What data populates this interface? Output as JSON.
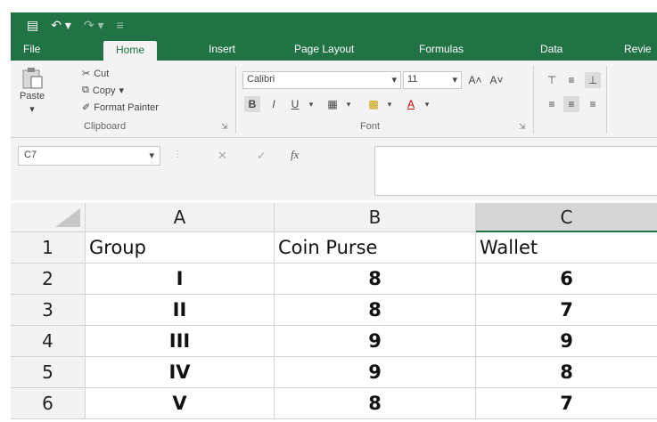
{
  "quick_access": {
    "save_glyph": "▤",
    "undo_glyph": "↶ ▾",
    "redo_glyph": "↷ ▾",
    "customize_glyph": "≡"
  },
  "tabs": [
    "File",
    "Home",
    "Insert",
    "Page Layout",
    "Formulas",
    "Data",
    "Revie"
  ],
  "clipboard": {
    "paste": "Paste",
    "paste_arrow": "▾",
    "cut": "Cut",
    "copy": "Copy",
    "copy_arrow": "▾",
    "format_painter": "Format Painter",
    "label": "Clipboard"
  },
  "font": {
    "name": "Calibri",
    "size": "11",
    "bold": "B",
    "italic": "I",
    "underline": "U",
    "grow": "A˄",
    "shrink": "A˅",
    "label": "Font"
  },
  "formula_bar": {
    "name_box": "C7",
    "cancel": "✕",
    "enter": "✓",
    "fx": "fx",
    "formula": ""
  },
  "sheet": {
    "columns": [
      "A",
      "B",
      "C"
    ],
    "rows": [
      {
        "num": "1",
        "cells": [
          "Group",
          "Coin Purse",
          "Wallet"
        ]
      },
      {
        "num": "2",
        "cells": [
          "I",
          "8",
          "6"
        ]
      },
      {
        "num": "3",
        "cells": [
          "II",
          "8",
          "7"
        ]
      },
      {
        "num": "4",
        "cells": [
          "III",
          "9",
          "9"
        ]
      },
      {
        "num": "5",
        "cells": [
          "IV",
          "9",
          "8"
        ]
      },
      {
        "num": "6",
        "cells": [
          "V",
          "8",
          "7"
        ]
      }
    ]
  },
  "colors": {
    "accent": "#217346",
    "ribbon": "#f3f3f3",
    "header": "#f2f2f2",
    "selected_header": "#d6d6d6"
  }
}
